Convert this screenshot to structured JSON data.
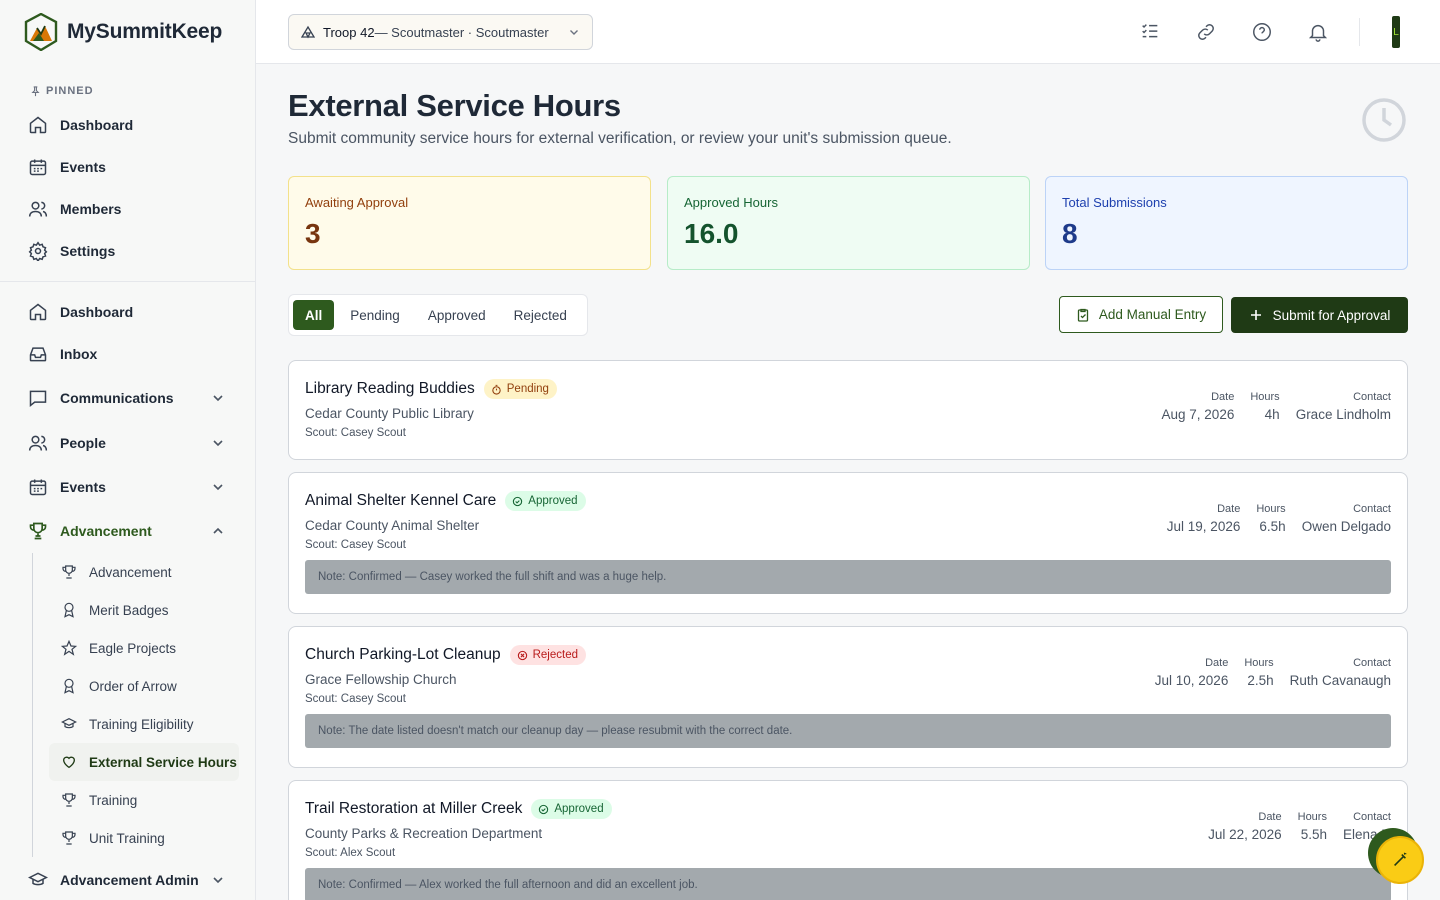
{
  "brand": {
    "name": "MySummitKeep"
  },
  "sidebar": {
    "pinned_label": "PINNED",
    "pinned": [
      {
        "label": "Dashboard",
        "icon": "home-icon"
      },
      {
        "label": "Events",
        "icon": "calendar-icon"
      },
      {
        "label": "Members",
        "icon": "users-icon"
      },
      {
        "label": "Settings",
        "icon": "gear-icon"
      }
    ],
    "main": [
      {
        "label": "Dashboard",
        "icon": "home-icon"
      },
      {
        "label": "Inbox",
        "icon": "inbox-icon"
      },
      {
        "label": "Communications",
        "icon": "chat-icon"
      },
      {
        "label": "People",
        "icon": "users-icon"
      },
      {
        "label": "Events",
        "icon": "calendar-icon"
      },
      {
        "label": "Advancement",
        "icon": "trophy-icon"
      }
    ],
    "advancement_sub": [
      {
        "label": "Advancement",
        "icon": "trophy-icon"
      },
      {
        "label": "Merit Badges",
        "icon": "award-icon"
      },
      {
        "label": "Eagle Projects",
        "icon": "star-icon"
      },
      {
        "label": "Order of Arrow",
        "icon": "award-icon"
      },
      {
        "label": "Training Eligibility",
        "icon": "graduation-cap-icon"
      },
      {
        "label": "External Service Hours",
        "icon": "heart-icon"
      },
      {
        "label": "Training",
        "icon": "trophy-icon"
      },
      {
        "label": "Unit Training",
        "icon": "trophy-icon"
      }
    ],
    "admin": {
      "label": "Advancement Admin",
      "icon": "graduation-cap-icon"
    }
  },
  "topbar": {
    "troop": "Troop 42",
    "troop_role": " — Scoutmaster · Scoutmaster",
    "avatar_initial": "L"
  },
  "page": {
    "title": "External Service Hours",
    "subtitle": "Submit community service hours for external verification, or review your unit's submission queue."
  },
  "stats": {
    "awaiting": {
      "label": "Awaiting Approval",
      "value": "3"
    },
    "approved": {
      "label": "Approved Hours",
      "value": "16.0"
    },
    "total": {
      "label": "Total Submissions",
      "value": "8"
    }
  },
  "tabs": [
    "All",
    "Pending",
    "Approved",
    "Rejected"
  ],
  "actions": {
    "manual": "Add Manual Entry",
    "submit": "Submit for Approval"
  },
  "meta_labels": {
    "date": "Date",
    "hours": "Hours",
    "contact": "Contact"
  },
  "submissions": [
    {
      "title": "Library Reading Buddies",
      "status": "Pending",
      "org": "Cedar County Public Library",
      "scout": "Scout: Casey Scout",
      "date": "Aug 7, 2026",
      "hours": "4h",
      "contact": "Grace Lindholm",
      "note": ""
    },
    {
      "title": "Animal Shelter Kennel Care",
      "status": "Approved",
      "org": "Cedar County Animal Shelter",
      "scout": "Scout: Casey Scout",
      "date": "Jul 19, 2026",
      "hours": "6.5h",
      "contact": "Owen Delgado",
      "note": "Note: Confirmed — Casey worked the full shift and was a huge help."
    },
    {
      "title": "Church Parking-Lot Cleanup",
      "status": "Rejected",
      "org": "Grace Fellowship Church",
      "scout": "Scout: Casey Scout",
      "date": "Jul 10, 2026",
      "hours": "2.5h",
      "contact": "Ruth Cavanaugh",
      "note": "Note: The date listed doesn't match our cleanup day — please resubmit with the correct date."
    },
    {
      "title": "Trail Restoration at Miller Creek",
      "status": "Approved",
      "org": "County Parks & Recreation Department",
      "scout": "Scout: Alex Scout",
      "date": "Jul 22, 2026",
      "hours": "5.5h",
      "contact": "Elena R",
      "note": "Note: Confirmed — Alex worked the full afternoon and did an excellent job."
    }
  ],
  "colors": {
    "primary": "#1f3a15",
    "accent_green": "#2e5a1e",
    "pending": "#92400e",
    "approved": "#166534",
    "rejected": "#b91c1c"
  }
}
